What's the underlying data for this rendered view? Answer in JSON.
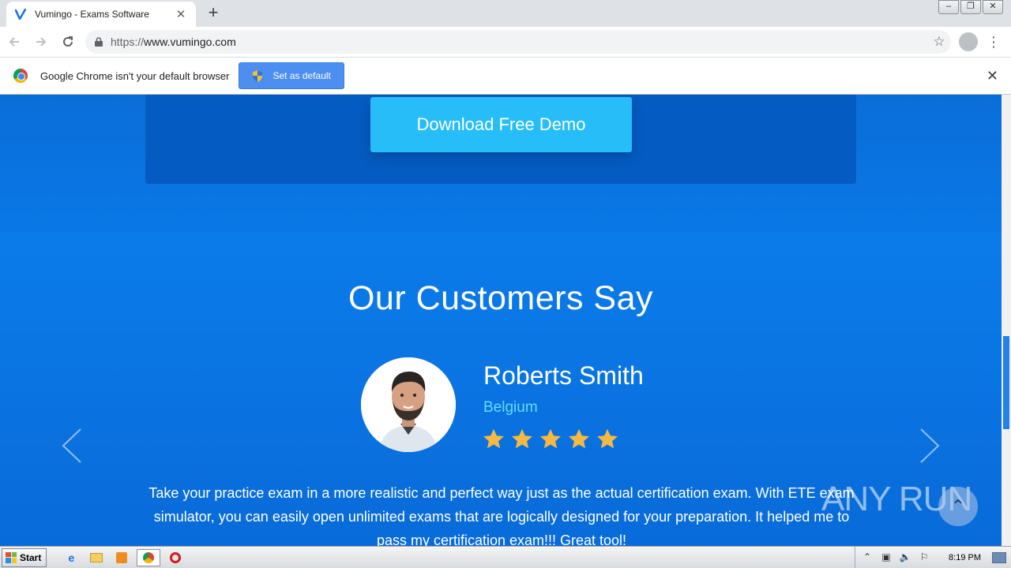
{
  "browser": {
    "tab_title": "Vumingo - Exams Software",
    "url_scheme": "https://",
    "url_host": "www.vumingo.com"
  },
  "infobar": {
    "message": "Google Chrome isn't your default browser",
    "button_label": "Set as default"
  },
  "page": {
    "demo_button_label": "Download Free Demo",
    "section_title": "Our Customers Say",
    "testimonial": {
      "name": "Roberts Smith",
      "country": "Belgium",
      "rating": 5,
      "rating_max": 5,
      "quote": "Take your practice exam in a more realistic and perfect way just as the actual certification exam. With ETE exam simulator, you can easily open unlimited exams that are logically designed for your preparation. It helped me to pass my certification exam!!! Great tool!"
    },
    "watermark": "ANY RUN"
  },
  "colors": {
    "page_blue": "#0a79e4",
    "demo_box": "#045cc2",
    "demo_button": "#27bdf9",
    "country_text": "#66d9ff",
    "star": "#f5b942"
  },
  "taskbar": {
    "start_label": "Start",
    "clock": "8:19 PM"
  }
}
